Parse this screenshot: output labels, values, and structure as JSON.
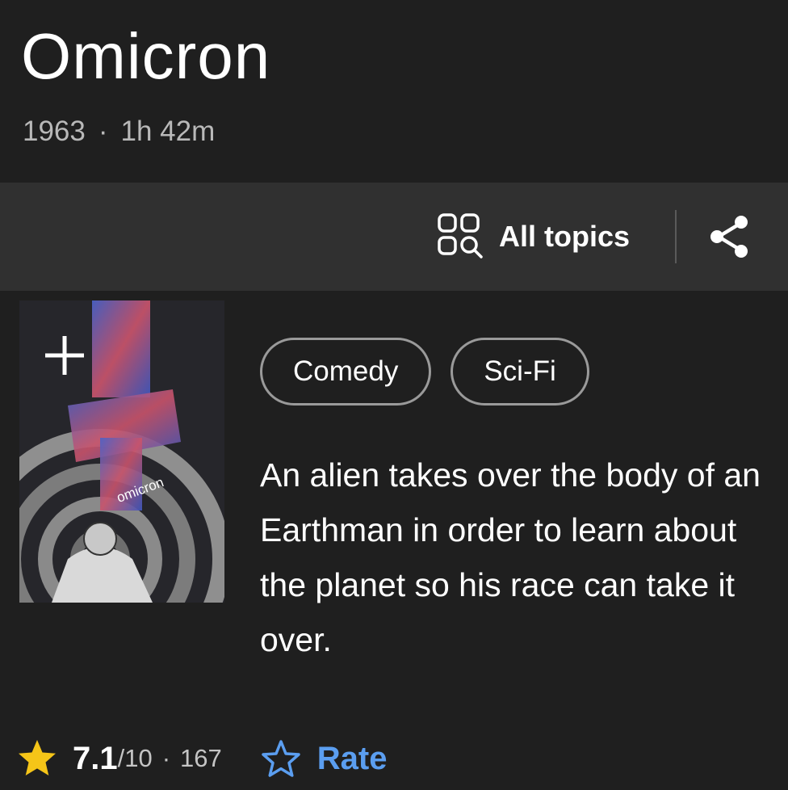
{
  "title": "Omicron",
  "meta": {
    "year": "1963",
    "separator": "·",
    "runtime": "1h 42m"
  },
  "toolbar": {
    "all_topics_label": "All topics",
    "all_topics_icon": "topics-grid-search-icon",
    "share_icon": "share-icon"
  },
  "poster": {
    "logo_text": "omicron",
    "add_icon": "plus-icon"
  },
  "genres": [
    "Comedy",
    "Sci-Fi"
  ],
  "plot": "An alien takes over the body of an Earthman in order to learn about the planet so his race can take it over.",
  "rating": {
    "value": "7.1",
    "max": "/10",
    "separator": "·",
    "count": "167",
    "star_color": "#f5c518"
  },
  "rate": {
    "label": "Rate",
    "color": "#5b9ef0"
  }
}
